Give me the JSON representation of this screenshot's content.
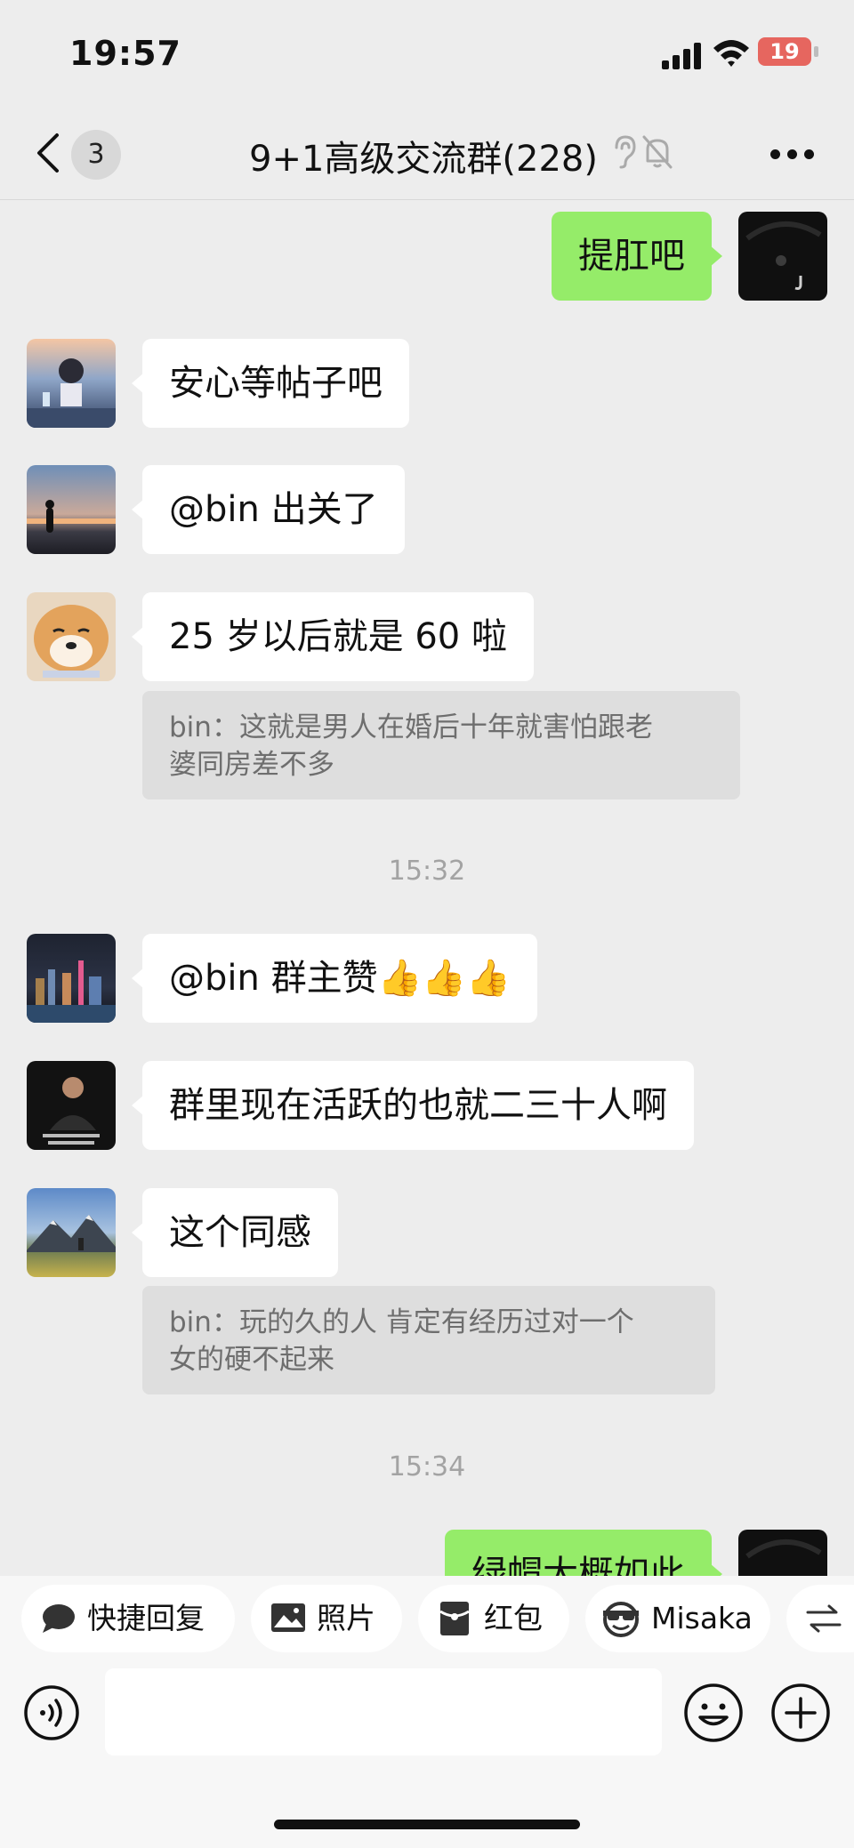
{
  "status_bar": {
    "time": "19:57",
    "battery": "19"
  },
  "header": {
    "unread_count": "3",
    "title": "9+1高级交流群(228)"
  },
  "messages": [
    {
      "text": "提肛吧"
    },
    {
      "text": "安心等帖子吧"
    },
    {
      "text": "@bin 出关了"
    },
    {
      "text": "25 岁以后就是 60 啦",
      "quote_line1": "bin：这就是男人在婚后十年就害怕跟老",
      "quote_line2": "婆同房差不多"
    },
    {
      "text": "@bin 群主赞👍👍👍"
    },
    {
      "text": "群里现在活跃的也就二三十人啊"
    },
    {
      "text": "这个同感",
      "quote_line1": "bin：玩的久的人 肯定有经历过对一个",
      "quote_line2": "女的硬不起来"
    },
    {
      "text": "绿帽大概如此"
    }
  ],
  "timestamps": [
    "15:32",
    "15:34"
  ],
  "quick_actions": [
    {
      "label": "快捷回复",
      "icon": "chat-bubble-icon"
    },
    {
      "label": "照片",
      "icon": "photo-icon"
    },
    {
      "label": "红包",
      "icon": "red-packet-icon"
    },
    {
      "label": "Misaka",
      "icon": "sunglasses-face-icon"
    }
  ],
  "colors": {
    "background": "#ededed",
    "my_bubble": "#95ec69",
    "other_bubble": "#ffffff",
    "quote_bg": "#dedede",
    "battery": "#e6665f"
  }
}
